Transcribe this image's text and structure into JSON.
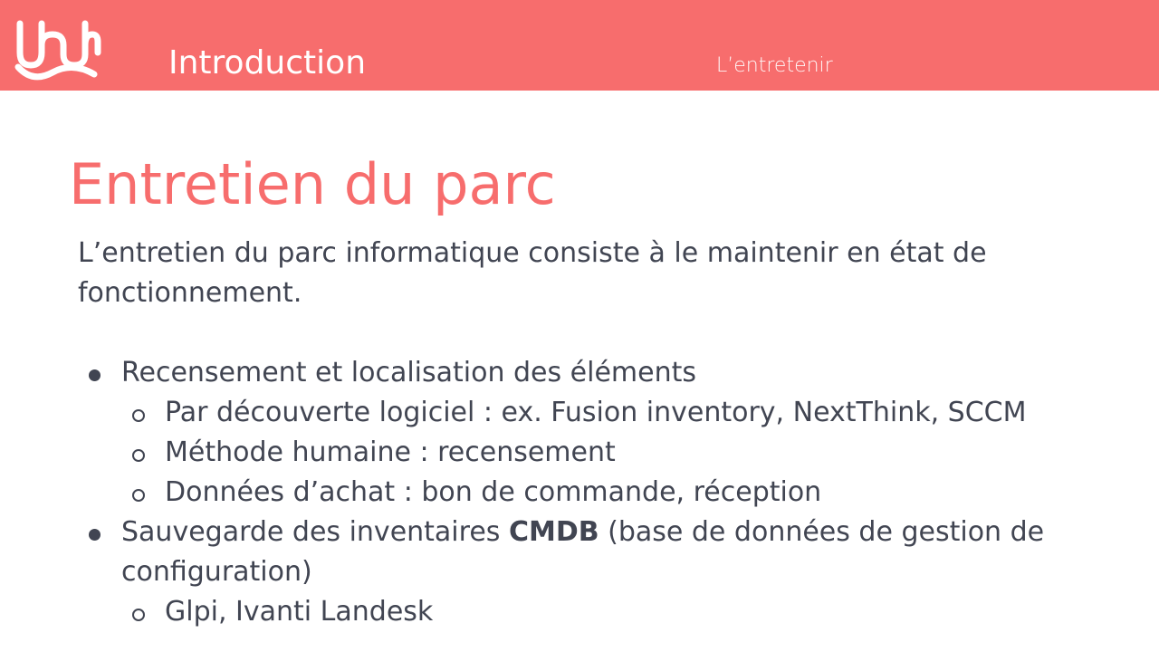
{
  "header": {
    "section_title": "Introduction",
    "section_subtitle": "L’entretenir",
    "background_color": "#F76D6D",
    "logo_icon": "wave-logo-icon"
  },
  "slide": {
    "title": "Entretien du parc",
    "intro": "L’entretien du parc informatique consiste à le maintenir en état de fonctionnement.",
    "bullets": [
      {
        "text": "Recensement et localisation des éléments",
        "sub": [
          "Par découverte logiciel : ex. Fusion inventory, NextThink, SCCM",
          "Méthode humaine : recensement",
          "Données d’achat : bon de commande, réception"
        ]
      },
      {
        "text_before": "Sauvegarde des inventaires ",
        "text_bold": "CMDB",
        "text_after": " (base de données de gestion de configuration)",
        "sub": [
          "Glpi, Ivanti Landesk"
        ]
      }
    ],
    "title_color": "#F76D6D",
    "text_color": "#414552"
  }
}
